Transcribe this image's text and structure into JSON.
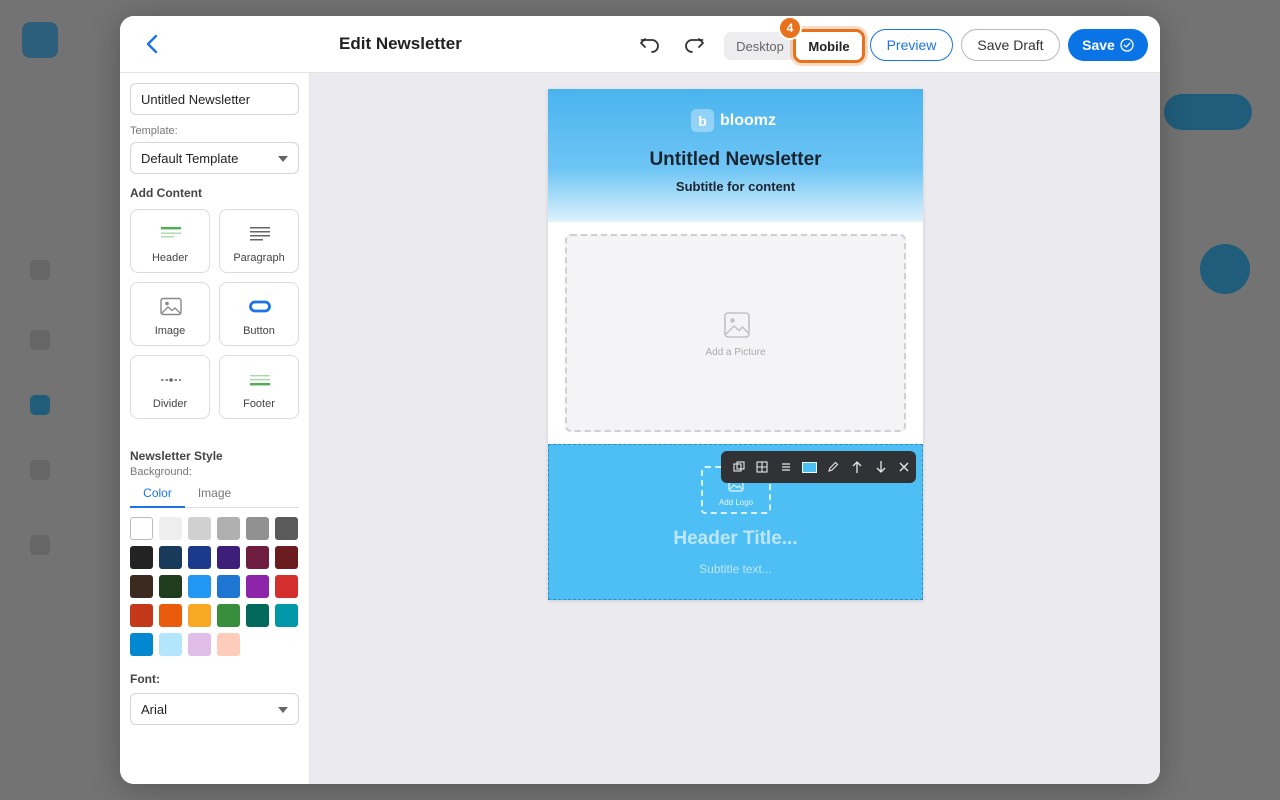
{
  "header": {
    "title": "Edit Newsletter",
    "view_desktop": "Desktop",
    "view_mobile": "Mobile",
    "step_badge": "4",
    "preview": "Preview",
    "save_draft": "Save Draft",
    "save": "Save"
  },
  "sidebar": {
    "name_value": "Untitled Newsletter",
    "template_label": "Template:",
    "template_value": "Default Template",
    "add_content_label": "Add Content",
    "blocks": [
      {
        "label": "Header",
        "icon": "header-block-icon"
      },
      {
        "label": "Paragraph",
        "icon": "paragraph-block-icon"
      },
      {
        "label": "Image",
        "icon": "image-block-icon"
      },
      {
        "label": "Button",
        "icon": "button-block-icon"
      },
      {
        "label": "Divider",
        "icon": "divider-block-icon"
      },
      {
        "label": "Footer",
        "icon": "footer-block-icon"
      }
    ],
    "style_label": "Newsletter Style",
    "background_label": "Background:",
    "tab_color": "Color",
    "tab_image": "Image",
    "swatches": [
      "#ffffff",
      "#efefef",
      "#d0d0d0",
      "#b0b0b0",
      "#919191",
      "#5a5a5a",
      "#232323",
      "#1a3a5c",
      "#1c3a8c",
      "#3d1f7a",
      "#6e1d41",
      "#6b1c1e",
      "#3b2a1d",
      "#1f3d1c",
      "#2196f3",
      "#1e76d2",
      "#8e24aa",
      "#d32f2f",
      "#c4381a",
      "#ea5c0c",
      "#f9a825",
      "#388e3c",
      "#00695c",
      "#0097a7",
      "#0288d1",
      "#b3e5fc",
      "#e1bee7",
      "#ffccbc"
    ],
    "font_label": "Font:",
    "font_value": "Arial"
  },
  "email": {
    "brand_letter": "b",
    "brand_name": "bloomz",
    "title": "Untitled Newsletter",
    "subtitle": "Subtitle for content",
    "picture_label": "Add a Picture",
    "logo_label": "Add Logo",
    "header_placeholder": "Header Title...",
    "subtitle_placeholder": "Subtitle text...",
    "header_color": "#4ebff4"
  },
  "toolbar_icons": [
    "duplicate-icon",
    "grid-icon",
    "align-icon",
    "color-swatch-icon",
    "edit-icon",
    "move-up-icon",
    "move-down-icon",
    "close-icon"
  ]
}
